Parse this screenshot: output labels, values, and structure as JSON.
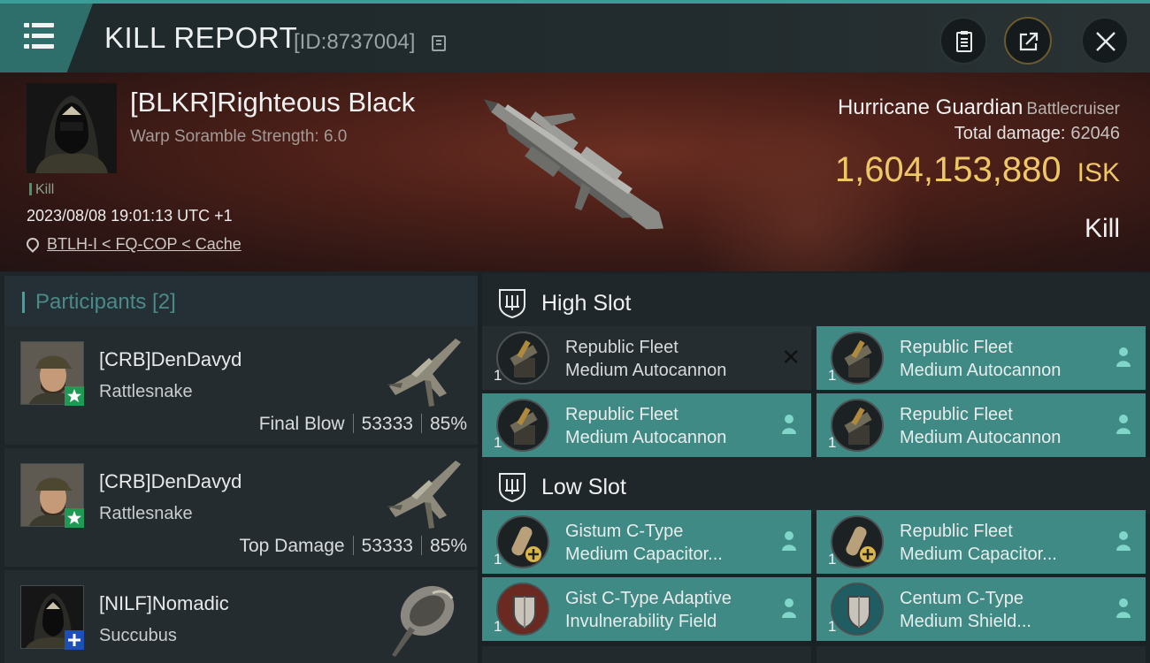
{
  "header": {
    "title": "KILL REPORT",
    "report_id": "[ID:8737004]"
  },
  "victim": {
    "name": "[BLKR]Righteous Black",
    "subtitle": "Warp Soramble Strength: 6.0",
    "tag": "Kill",
    "timestamp": "2023/08/08 19:01:13 UTC +1",
    "location": "BTLH-I < FQ-COP < Cache",
    "ship_name": "Hurricane Guardian",
    "ship_class": "Battlecruiser",
    "total_damage_label": "Total damage:",
    "total_damage": "62046",
    "isk_value": "1,604,153,880",
    "isk_unit": "ISK",
    "result": "Kill"
  },
  "participants": {
    "header": "Participants [2]",
    "rows": [
      {
        "name": "[CRB]DenDavyd",
        "ship": "Rattlesnake",
        "role": "Final Blow",
        "damage": "53333",
        "percent": "85%",
        "badge": "star"
      },
      {
        "name": "[CRB]DenDavyd",
        "ship": "Rattlesnake",
        "role": "Top Damage",
        "damage": "53333",
        "percent": "85%",
        "badge": "star"
      },
      {
        "name": "[NILF]Nomadic",
        "ship": "Succubus",
        "role": "",
        "damage": "",
        "percent": "",
        "badge": "plus"
      }
    ]
  },
  "fitting": {
    "high_slot_label": "High Slot",
    "low_slot_label": "Low Slot",
    "high": [
      {
        "line1": "Republic Fleet",
        "line2": "Medium Autocannon",
        "qty": "1",
        "marker": "x",
        "style": "dark"
      },
      {
        "line1": "Republic Fleet",
        "line2": "Medium Autocannon",
        "qty": "1",
        "marker": "person",
        "style": "teal"
      },
      {
        "line1": "Republic Fleet",
        "line2": "Medium Autocannon",
        "qty": "1",
        "marker": "person",
        "style": "teal"
      },
      {
        "line1": "Republic Fleet",
        "line2": "Medium Autocannon",
        "qty": "1",
        "marker": "person",
        "style": "teal"
      }
    ],
    "low": [
      {
        "line1": "Gistum C-Type",
        "line2": "Medium Capacitor...",
        "qty": "1",
        "marker": "person",
        "style": "teal"
      },
      {
        "line1": "Republic Fleet",
        "line2": "Medium Capacitor...",
        "qty": "1",
        "marker": "person",
        "style": "teal"
      },
      {
        "line1": "Gist C-Type Adaptive",
        "line2": "Invulnerability Field",
        "qty": "1",
        "marker": "person",
        "style": "teal"
      },
      {
        "line1": "Centum C-Type",
        "line2": "Medium Shield...",
        "qty": "1",
        "marker": "person",
        "style": "teal"
      }
    ]
  },
  "colors": {
    "accent_teal": "#3f8a84",
    "isk_gold": "#f0c766",
    "banner_red": "#4a1f18"
  }
}
